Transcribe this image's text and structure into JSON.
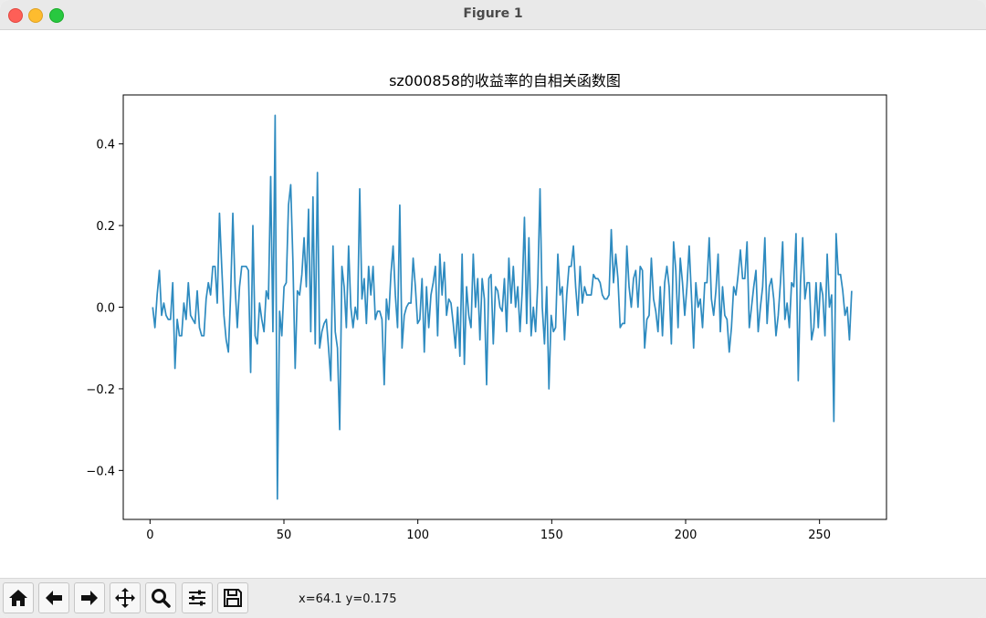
{
  "window": {
    "title": "Figure 1",
    "traffic_colors": {
      "close": "#fe5f57",
      "minimize": "#febc2e",
      "maximize": "#28c840"
    }
  },
  "toolbar": {
    "buttons": [
      "home-icon",
      "back-arrow-icon",
      "forward-arrow-icon",
      "pan-move-icon",
      "zoom-magnifier-icon",
      "configure-subplots-icon",
      "save-disk-icon"
    ],
    "coords_text": "x=64.1 y=0.175"
  },
  "chart_data": {
    "type": "line",
    "title": "sz000858的收益率的自相关函数图",
    "xlabel": "",
    "ylabel": "",
    "xlim": [
      -10,
      275
    ],
    "ylim": [
      -0.52,
      0.52
    ],
    "xticks": [
      0,
      50,
      100,
      150,
      200,
      250
    ],
    "xtick_labels": [
      "0",
      "50",
      "100",
      "150",
      "200",
      "250"
    ],
    "yticks": [
      -0.4,
      -0.2,
      0.0,
      0.2,
      0.4
    ],
    "ytick_labels": [
      "−0.4",
      "−0.2",
      "0.0",
      "0.2",
      "0.4"
    ],
    "grid": false,
    "line_color": "#2e8bc0",
    "series": [
      {
        "x_start": 1,
        "values": [
          0.0,
          -0.05,
          0.03,
          0.09,
          -0.02,
          0.01,
          -0.02,
          -0.03,
          -0.03,
          0.06,
          -0.15,
          -0.03,
          -0.07,
          -0.07,
          0.01,
          -0.03,
          0.06,
          -0.02,
          -0.03,
          -0.04,
          0.04,
          -0.05,
          -0.07,
          -0.07,
          0.02,
          0.06,
          0.03,
          0.1,
          0.1,
          0.01,
          0.23,
          0.1,
          -0.02,
          -0.08,
          -0.11,
          0.03,
          0.23,
          0.05,
          -0.05,
          0.05,
          0.1,
          0.1,
          0.1,
          0.09,
          -0.16,
          0.2,
          -0.07,
          -0.09,
          0.01,
          -0.03,
          -0.06,
          0.04,
          0.02,
          0.32,
          -0.06,
          0.47,
          -0.47,
          -0.01,
          -0.07,
          0.05,
          0.06,
          0.25,
          0.3,
          0.11,
          -0.15,
          0.04,
          0.03,
          0.08,
          0.17,
          0.05,
          0.24,
          -0.06,
          0.27,
          -0.09,
          0.33,
          -0.1,
          -0.06,
          -0.04,
          -0.03,
          -0.1,
          -0.18,
          0.15,
          -0.06,
          -0.1,
          -0.3,
          0.1,
          0.05,
          -0.05,
          0.15,
          0.0,
          -0.05,
          0.0,
          -0.03,
          0.29,
          0.02,
          0.07,
          -0.04,
          0.1,
          0.03,
          0.1,
          -0.03,
          -0.01,
          -0.01,
          -0.03,
          -0.19,
          0.02,
          -0.03,
          0.08,
          0.15,
          0.03,
          -0.05,
          0.25,
          -0.1,
          -0.02,
          0.0,
          0.01,
          0.01,
          0.12,
          0.05,
          -0.04,
          -0.03,
          0.07,
          -0.11,
          0.05,
          -0.05,
          0.03,
          0.06,
          0.1,
          -0.07,
          0.13,
          0.03,
          0.11,
          -0.02,
          0.02,
          0.01,
          -0.04,
          -0.1,
          0.0,
          -0.12,
          0.13,
          -0.14,
          0.05,
          -0.02,
          -0.05,
          0.13,
          0.0,
          0.07,
          -0.08,
          0.07,
          0.02,
          -0.19,
          0.07,
          0.08,
          -0.09,
          0.05,
          0.04,
          0.0,
          -0.01,
          0.07,
          -0.06,
          0.12,
          0.01,
          0.1,
          0.0,
          0.05,
          -0.06,
          0.04,
          0.22,
          -0.04,
          0.17,
          -0.07,
          0.0,
          -0.06,
          0.06,
          0.29,
          0.0,
          -0.09,
          0.05,
          -0.2,
          -0.02,
          -0.06,
          -0.05,
          0.13,
          0.03,
          0.05,
          -0.08,
          0.03,
          0.1,
          0.1,
          0.15,
          0.05,
          -0.02,
          0.1,
          0.01,
          0.05,
          0.03,
          0.03,
          0.03,
          0.08,
          0.07,
          0.07,
          0.06,
          0.03,
          0.02,
          0.02,
          0.03,
          0.19,
          0.06,
          0.13,
          0.07,
          -0.05,
          -0.04,
          -0.04,
          0.15,
          0.05,
          0.0,
          0.07,
          0.09,
          0.0,
          0.1,
          0.09,
          -0.1,
          -0.03,
          -0.02,
          0.12,
          0.02,
          -0.01,
          -0.06,
          0.05,
          -0.07,
          0.06,
          0.1,
          0.05,
          -0.09,
          0.16,
          0.09,
          -0.05,
          0.12,
          0.06,
          -0.02,
          0.05,
          0.15,
          0.03,
          -0.1,
          0.06,
          0.0,
          0.02,
          -0.05,
          0.06,
          0.06,
          0.17,
          0.02,
          -0.02,
          0.04,
          0.13,
          -0.06,
          0.05,
          -0.02,
          -0.03,
          -0.11,
          -0.05,
          0.05,
          0.03,
          0.08,
          0.14,
          0.07,
          0.07,
          0.16,
          -0.05,
          0.0,
          0.05,
          0.09,
          -0.06,
          0.0,
          0.05,
          0.17,
          -0.04,
          0.05,
          0.07,
          0.02,
          -0.07,
          -0.02,
          0.06,
          0.16,
          -0.03,
          0.01,
          -0.05,
          0.06,
          0.05,
          0.18,
          -0.18,
          0.06,
          0.17,
          0.02,
          0.06,
          0.06,
          -0.08,
          -0.05,
          0.06,
          -0.05,
          0.06,
          0.03,
          -0.07,
          0.13,
          0.0,
          0.03,
          -0.28,
          0.18,
          0.08,
          0.08,
          0.04,
          -0.02,
          0.0,
          -0.08,
          0.04
        ]
      }
    ]
  }
}
